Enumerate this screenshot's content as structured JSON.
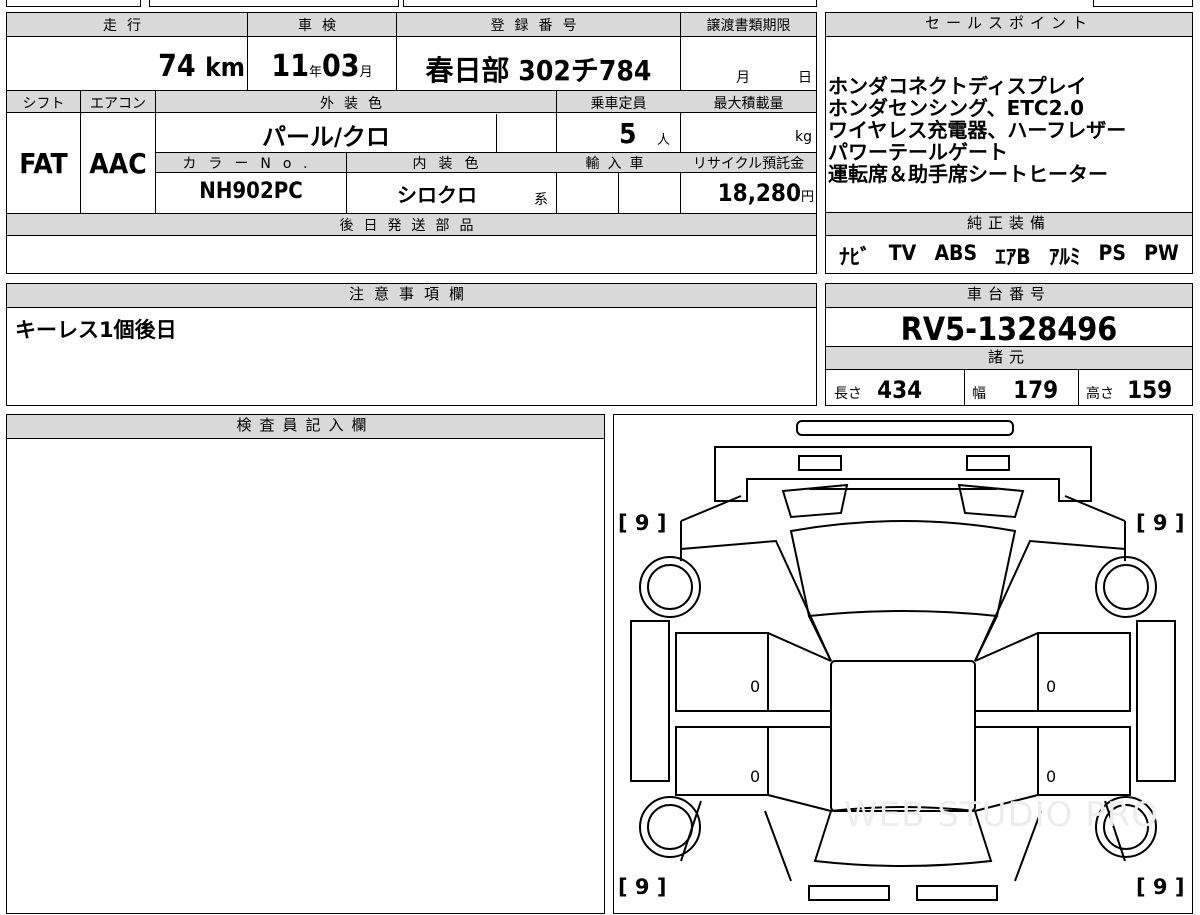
{
  "mileage": {
    "label": "走行",
    "value": "74",
    "unit": "km"
  },
  "inspection": {
    "label": "車検",
    "year": "11",
    "year_unit": "年",
    "month": "03",
    "month_unit": "月"
  },
  "registration": {
    "label": "登録番号",
    "value": "春日部 302チ784"
  },
  "transfer_deadline": {
    "label": "譲渡書類期限",
    "month_unit": "月",
    "day_unit": "日"
  },
  "shift": {
    "label": "シフト",
    "value": "FAT"
  },
  "aircon": {
    "label": "エアコン",
    "value": "AAC"
  },
  "exterior_color": {
    "label": "外装色",
    "value": "パール/クロ"
  },
  "capacity": {
    "label": "乗車定員",
    "value": "5",
    "unit": "人"
  },
  "max_load": {
    "label": "最大積載量",
    "unit": "kg"
  },
  "color_no": {
    "label": "カラーNo.",
    "value": "NH902PC"
  },
  "interior_color": {
    "label": "内装色",
    "value": "シロクロ",
    "suffix": "系"
  },
  "import": {
    "label": "輸入車"
  },
  "recycle": {
    "label": "リサイクル預託金",
    "value": "18,280",
    "unit": "円"
  },
  "later_parts": {
    "label": "後日発送部品"
  },
  "sales_points": {
    "label": "セールスポイント",
    "lines": [
      "ホンダコネクトディスプレイ",
      "ホンダセンシング、ETC2.0",
      "ワイヤレス充電器、ハーフレザー",
      "パワーテールゲート",
      "運転席＆助手席シートヒーター"
    ]
  },
  "equipment": {
    "label": "純正装備",
    "items": [
      "ﾅﾋﾞ",
      "TV",
      "ABS",
      "ｴｱB",
      "ｱﾙﾐ",
      "PS",
      "PW"
    ]
  },
  "notes": {
    "label": "注意事項欄",
    "text": "キーレス1個後日"
  },
  "chassis": {
    "label": "車台番号",
    "value": "RV5-1328496"
  },
  "specs": {
    "label": "諸元",
    "length_label": "長さ",
    "length": "434",
    "width_label": "幅",
    "width": "179",
    "height_label": "高さ",
    "height": "159"
  },
  "inspector": {
    "label": "検査員記入欄"
  },
  "diagram": {
    "tire_fl": "9",
    "tire_fr": "9",
    "tire_rl": "9",
    "tire_rr": "9",
    "door_fl": "0",
    "door_fr": "0",
    "door_rl": "0",
    "door_rr": "0",
    "watermark": "WEB STUDIO PRO"
  }
}
